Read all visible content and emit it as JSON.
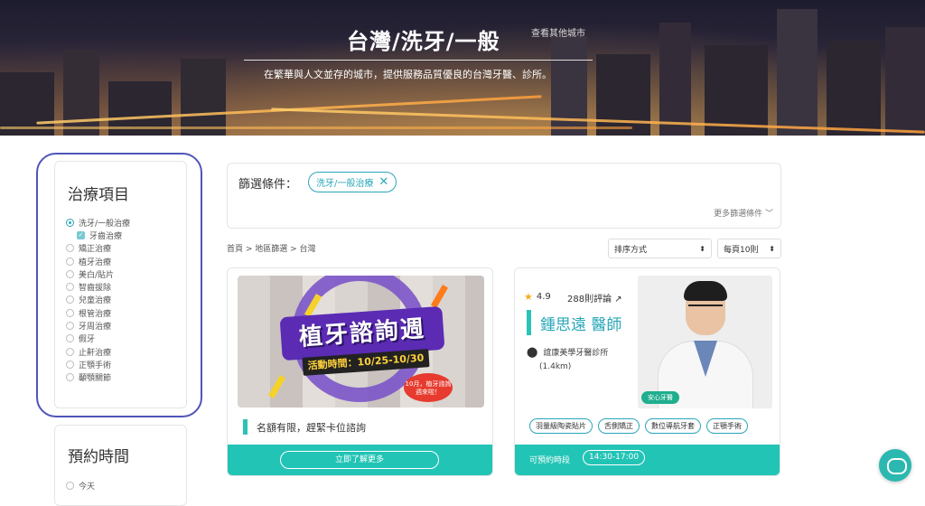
{
  "hero": {
    "title": "台灣/洗牙/一般",
    "other_cities": "查看其他城市",
    "subtitle": "在繁華與人文並存的城市，提供服務品質優良的台灣牙醫、診所。"
  },
  "sidebar": {
    "treatment_title": "治療項目",
    "treatments": [
      {
        "label": "洗牙/一般治療",
        "selected": true
      },
      {
        "label": "牙齒治療",
        "checked": true,
        "sub": true
      },
      {
        "label": "矯正治療"
      },
      {
        "label": "植牙治療"
      },
      {
        "label": "美白/貼片"
      },
      {
        "label": "智齒拔除"
      },
      {
        "label": "兒童治療"
      },
      {
        "label": "根管治療"
      },
      {
        "label": "牙周治療"
      },
      {
        "label": "假牙"
      },
      {
        "label": "止鼾治療"
      },
      {
        "label": "正顎手術"
      },
      {
        "label": "顳顎關節"
      }
    ],
    "booking_title": "預約時間",
    "booking_first_option": "今天"
  },
  "filter": {
    "label": "篩選條件：",
    "chip": "洗牙/一般治療",
    "more": "更多篩選條件"
  },
  "breadcrumb": "首頁 > 地區篩選 > 台灣",
  "sort": {
    "label": "排序方式",
    "per_page": "每頁10則"
  },
  "promo_card": {
    "banner_title": "植牙諮詢週",
    "banner_date": "活動時間：10/25-10/30",
    "banner_tag": "10月，植牙諮詢週來啦！",
    "note": "名額有限，趕緊卡位諮詢",
    "button": "立即了解更多"
  },
  "doctor_card": {
    "rating": "4.9",
    "reviews": "288則評論",
    "name": "鍾思遠 醫師",
    "clinic": "誼康美學牙醫診所",
    "distance": "(1.4km)",
    "badge": "安心牙醫",
    "tags": [
      "羽量級陶瓷貼片",
      "舌側矯正",
      "數位導航牙套",
      "正顎手術"
    ],
    "available_label": "可預約時段",
    "slot": "14:30-17:00"
  },
  "colors": {
    "accent": "#22c4b5",
    "link": "#2aa7b8",
    "highlight_ring": "#4f55b9"
  }
}
